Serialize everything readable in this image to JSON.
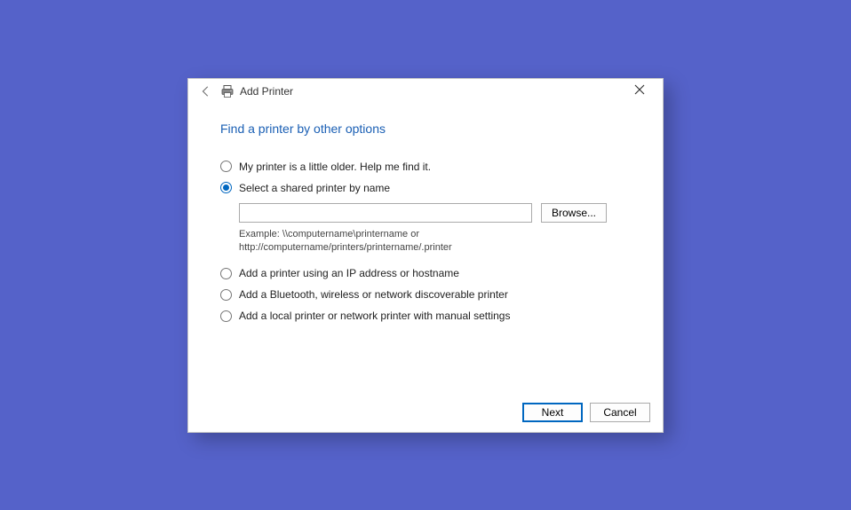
{
  "titlebar": {
    "label": "Add Printer"
  },
  "heading": "Find a printer by other options",
  "options": {
    "older": "My printer is a little older. Help me find it.",
    "shared": "Select a shared printer by name",
    "ip": "Add a printer using an IP address or hostname",
    "bluetooth": "Add a Bluetooth, wireless or network discoverable printer",
    "local": "Add a local printer or network printer with manual settings"
  },
  "shared_section": {
    "input_value": "",
    "input_placeholder": "",
    "browse_label": "Browse...",
    "example": "Example: \\\\computername\\printername or http://computername/printers/printername/.printer"
  },
  "footer": {
    "next": "Next",
    "cancel": "Cancel"
  }
}
